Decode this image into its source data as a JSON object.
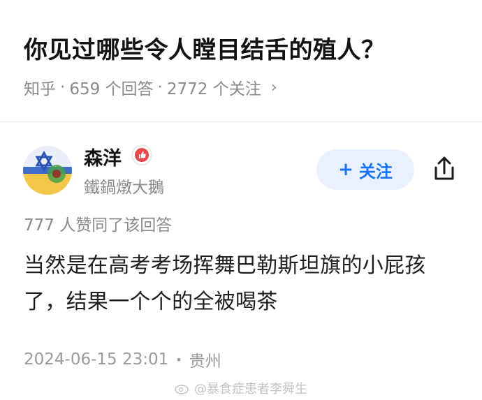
{
  "question": {
    "title": "你见过哪些令人瞠目结舌的殖人？",
    "source": "知乎",
    "answers": "659 个回答",
    "followers": "2772 个关注",
    "sep": "·"
  },
  "author": {
    "name": "森洋",
    "subtitle": "鐵鍋燉大鵝",
    "follow_label": "关注",
    "follow_plus": "+"
  },
  "answer": {
    "likes_text": "777 人赞同了该回答",
    "body": "当然是在高考考场挥舞巴勒斯坦旗的小屁孩了，结果一个个的全被喝茶",
    "date": "2024-06-15 23:01",
    "location": "贵州",
    "sep": "•"
  },
  "watermark": {
    "text": "@暴食症患者李舜生"
  },
  "colors": {
    "accent": "#1772f6",
    "muted": "#8a8a8a"
  },
  "icons": {
    "share": "share-icon",
    "chevron": "chevron-right-icon",
    "badge": "thumb-badge-icon"
  }
}
